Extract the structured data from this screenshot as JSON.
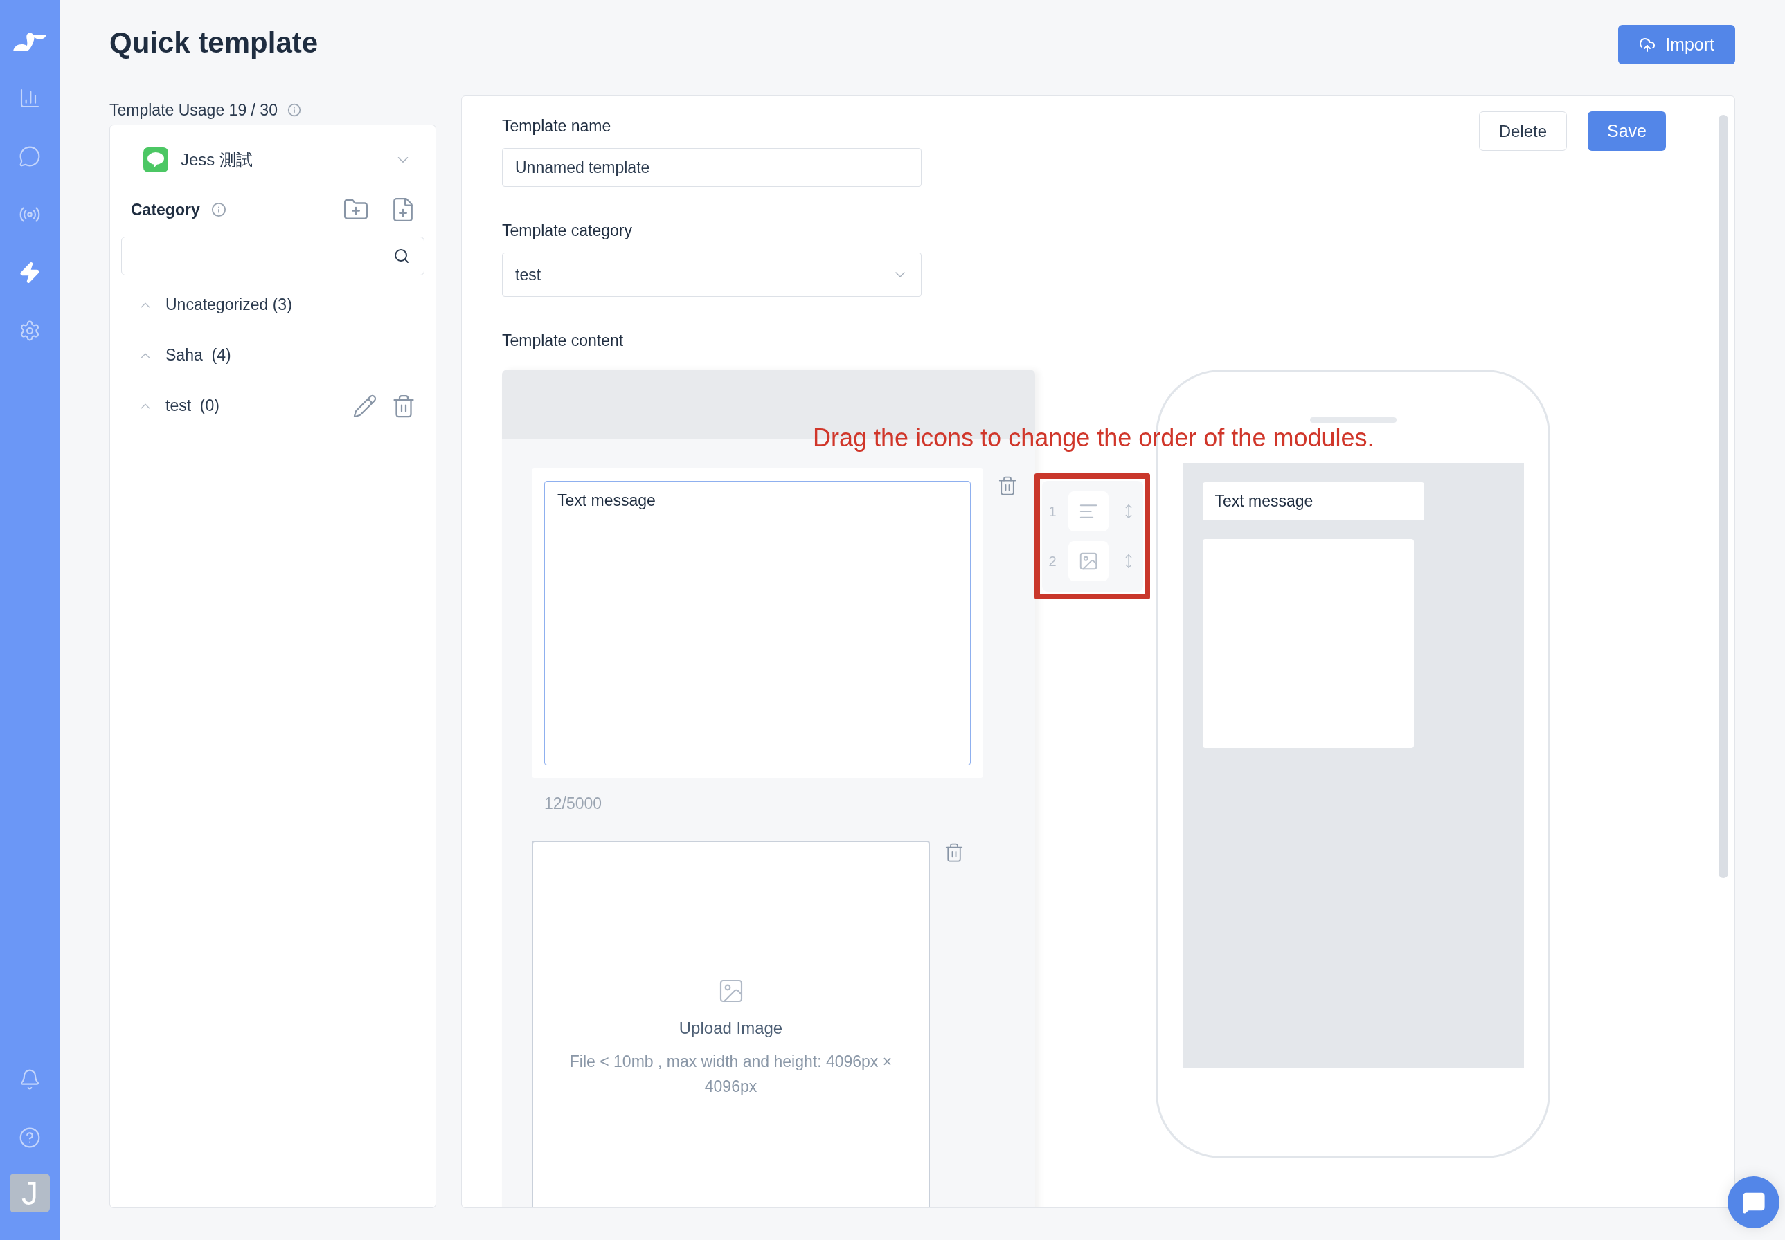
{
  "nav": {
    "items": [
      {
        "kind": "chart",
        "selected": false
      },
      {
        "kind": "chat",
        "selected": false
      },
      {
        "kind": "broadcast",
        "selected": false
      },
      {
        "kind": "automation",
        "selected": true
      },
      {
        "kind": "settings",
        "selected": false
      }
    ],
    "bottom_items": [
      {
        "kind": "bell"
      },
      {
        "kind": "help"
      }
    ],
    "avatar": {
      "initial": "J"
    }
  },
  "header": {
    "title": "Quick template",
    "import_button": "Import"
  },
  "usage": "Template Usage 19 / 30",
  "sidebar": {
    "channel": {
      "name": "Jess 測試"
    },
    "category_label": "Category",
    "categories": [
      {
        "name": "Uncategorized (3)",
        "show_actions": false
      },
      {
        "name": "Saha  (4)",
        "show_actions": false
      },
      {
        "name": "test  (0)",
        "show_actions": true
      }
    ]
  },
  "editor": {
    "buttons": {
      "delete": "Delete",
      "save": "Save"
    },
    "template_name": {
      "label": "Template name",
      "value": "Unnamed template"
    },
    "template_category": {
      "label": "Template category",
      "value": "test"
    },
    "content_label": "Template content",
    "modules": [
      {
        "kind": "text",
        "value": "Text message",
        "counter": "12/5000"
      },
      {
        "kind": "image",
        "title": "Upload Image",
        "hint": "File < 10mb , max width and height: 4096px × 4096px"
      }
    ],
    "order": [
      {
        "number": "1",
        "kind": "text"
      },
      {
        "number": "2",
        "kind": "image"
      }
    ],
    "annotation": "Drag the icons to change the order of the modules.",
    "preview": [
      {
        "kind": "text",
        "text": "Text message"
      },
      {
        "kind": "image"
      }
    ]
  }
}
